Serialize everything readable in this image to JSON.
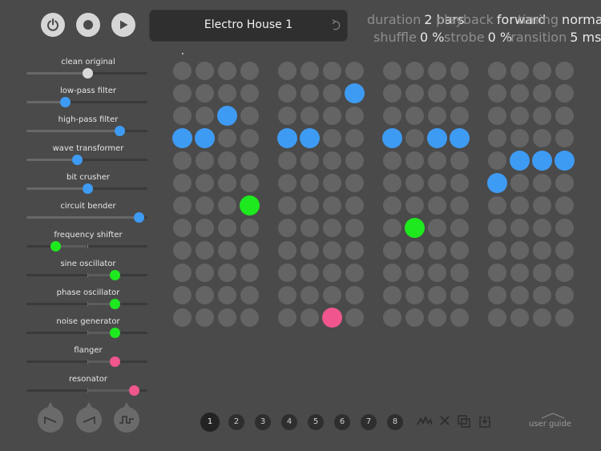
{
  "colors": {
    "blue": "#3e9bf4",
    "green": "#1ee81e",
    "pink": "#f0568d",
    "off": "#646464"
  },
  "transport": {
    "power_icon": "power-icon",
    "record_icon": "record-icon",
    "play_icon": "play-icon"
  },
  "preset": {
    "name": "Electro House 1",
    "undo_icon": "undo-icon"
  },
  "params": [
    {
      "label": "duration",
      "value": "2 bars"
    },
    {
      "label": "playback",
      "value": "forward"
    },
    {
      "label": "timing",
      "value": "normal"
    },
    {
      "label": "shuffle",
      "value": "0 %"
    },
    {
      "label": "strobe",
      "value": "0 %"
    },
    {
      "label": "transition",
      "value": "5 ms"
    }
  ],
  "effects": [
    {
      "label": "clean original",
      "value": 0.5,
      "knob_color": "#d8d8d8",
      "bipolar": false
    },
    {
      "label": "low-pass filter",
      "value": 0.32,
      "knob_color": "#3e9bf4",
      "bipolar": false
    },
    {
      "label": "high-pass filter",
      "value": 0.77,
      "knob_color": "#3e9bf4",
      "bipolar": false
    },
    {
      "label": "wave transformer",
      "value": 0.42,
      "knob_color": "#3e9bf4",
      "bipolar": false
    },
    {
      "label": "bit crusher",
      "value": 0.5,
      "knob_color": "#3e9bf4",
      "bipolar": false
    },
    {
      "label": "circuit bender",
      "value": 0.93,
      "knob_color": "#3e9bf4",
      "bipolar": false
    },
    {
      "label": "frequency shifter",
      "value": 0.24,
      "knob_color": "#1ee81e",
      "bipolar": true
    },
    {
      "label": "sine oscillator",
      "value": 0.73,
      "knob_color": "#1ee81e",
      "bipolar": true
    },
    {
      "label": "phase oscillator",
      "value": 0.73,
      "knob_color": "#1ee81e",
      "bipolar": true
    },
    {
      "label": "noise generator",
      "value": 0.73,
      "knob_color": "#1ee81e",
      "bipolar": true
    },
    {
      "label": "flanger",
      "value": 0.73,
      "knob_color": "#f0568d",
      "bipolar": true
    },
    {
      "label": "resonator",
      "value": 0.89,
      "knob_color": "#f0568d",
      "bipolar": true
    }
  ],
  "grid": {
    "rows": 12,
    "cols": 16,
    "active": [
      {
        "row": 1,
        "col": 7,
        "color": "blue"
      },
      {
        "row": 2,
        "col": 2,
        "color": "blue"
      },
      {
        "row": 3,
        "col": 0,
        "color": "blue"
      },
      {
        "row": 3,
        "col": 1,
        "color": "blue"
      },
      {
        "row": 3,
        "col": 4,
        "color": "blue"
      },
      {
        "row": 3,
        "col": 5,
        "color": "blue"
      },
      {
        "row": 3,
        "col": 8,
        "color": "blue"
      },
      {
        "row": 3,
        "col": 10,
        "color": "blue"
      },
      {
        "row": 3,
        "col": 11,
        "color": "blue"
      },
      {
        "row": 4,
        "col": 13,
        "color": "blue"
      },
      {
        "row": 4,
        "col": 14,
        "color": "blue"
      },
      {
        "row": 4,
        "col": 15,
        "color": "blue"
      },
      {
        "row": 5,
        "col": 12,
        "color": "blue"
      },
      {
        "row": 6,
        "col": 3,
        "color": "green"
      },
      {
        "row": 7,
        "col": 9,
        "color": "green"
      },
      {
        "row": 11,
        "col": 6,
        "color": "pink"
      }
    ]
  },
  "lfo_shapes": [
    "saw-down-icon",
    "saw-up-icon",
    "square-wave-icon"
  ],
  "pages": {
    "items": [
      "1",
      "2",
      "3",
      "4",
      "5",
      "6",
      "7",
      "8"
    ],
    "active": 0
  },
  "tools": [
    "randomize-icon",
    "clear-icon",
    "copy-icon",
    "paste-icon"
  ],
  "user_guide": "user guide"
}
